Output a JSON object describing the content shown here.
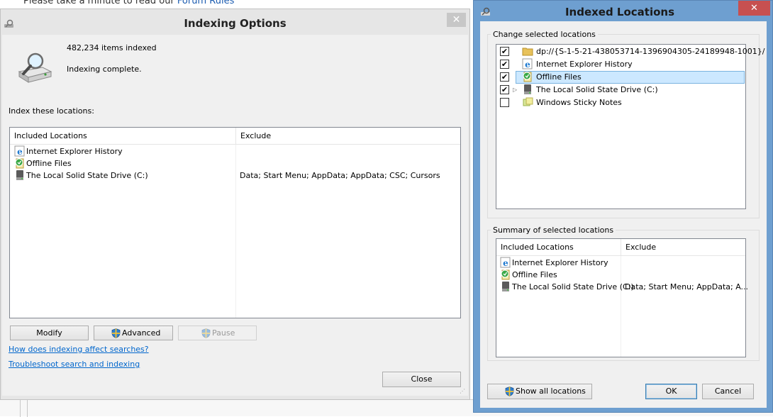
{
  "background": {
    "prefix_text": "Please take a minute to read our ",
    "link_text": "Forum Rules"
  },
  "indexing_options": {
    "title": "Indexing Options",
    "close_glyph": "✕",
    "items_indexed": "482,234 items indexed",
    "status": "Indexing complete.",
    "index_label": "Index these locations:",
    "columns": [
      "Included Locations",
      "Exclude"
    ],
    "rows": [
      {
        "icon": "internet-explorer-icon",
        "name": "Internet Explorer History",
        "exclude": ""
      },
      {
        "icon": "offline-files-icon",
        "name": "Offline Files",
        "exclude": ""
      },
      {
        "icon": "drive-icon",
        "name": "The Local Solid State Drive (C:)",
        "exclude": "Data; Start Menu; AppData; AppData; CSC; Cursors"
      }
    ],
    "buttons": {
      "modify": "Modify",
      "advanced": "Advanced",
      "pause": "Pause",
      "close": "Close"
    },
    "links": {
      "how": "How does indexing affect searches?",
      "troubleshoot": "Troubleshoot search and indexing"
    }
  },
  "indexed_locations": {
    "title": "Indexed Locations",
    "close_glyph": "✕",
    "change_label": "Change selected locations",
    "tree": [
      {
        "checked": true,
        "icon": "folder-icon",
        "label": "dp://{S-1-5-21-438053714-1396904305-24189948-1001}/",
        "selected": false,
        "expander": false
      },
      {
        "checked": true,
        "icon": "internet-explorer-icon",
        "label": "Internet Explorer History",
        "selected": false,
        "expander": false
      },
      {
        "checked": true,
        "icon": "offline-files-icon",
        "label": "Offline Files",
        "selected": true,
        "expander": false
      },
      {
        "checked": true,
        "icon": "drive-icon",
        "label": "The Local Solid State Drive (C:)",
        "selected": false,
        "expander": true
      },
      {
        "checked": false,
        "icon": "sticky-notes-icon",
        "label": "Windows Sticky Notes",
        "selected": false,
        "expander": false
      }
    ],
    "summary_label": "Summary of selected locations",
    "columns": [
      "Included Locations",
      "Exclude"
    ],
    "rows": [
      {
        "icon": "internet-explorer-icon",
        "name": "Internet Explorer History",
        "exclude": ""
      },
      {
        "icon": "offline-files-icon",
        "name": "Offline Files",
        "exclude": ""
      },
      {
        "icon": "drive-icon",
        "name": "The Local Solid State Drive (C:)",
        "exclude": "Data; Start Menu; AppData; A..."
      }
    ],
    "buttons": {
      "show_all": "Show all locations",
      "ok": "OK",
      "cancel": "Cancel"
    }
  },
  "colors": {
    "accent": "#6e9fd0",
    "close_red": "#c75050",
    "link": "#0066cc",
    "selection": "#cce8ff"
  }
}
